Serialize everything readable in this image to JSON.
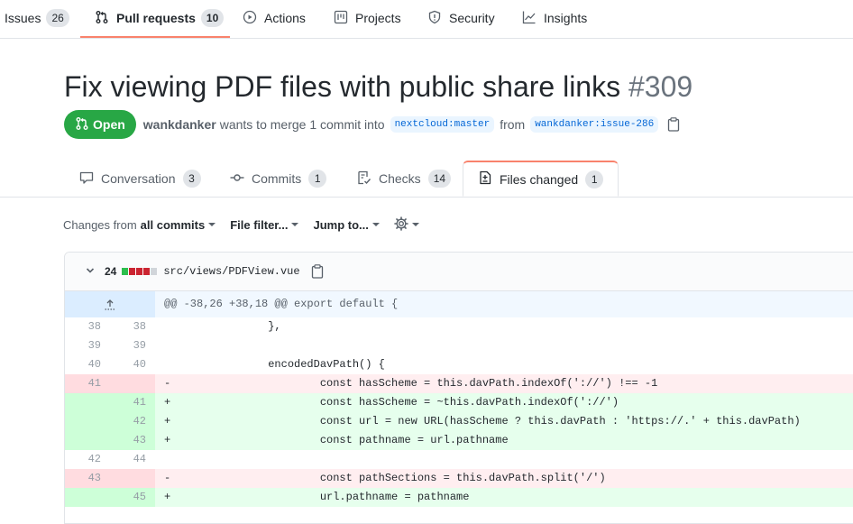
{
  "repo_nav": {
    "items": [
      {
        "label": "Issues",
        "count": "26",
        "icon": "issue-icon"
      },
      {
        "label": "Pull requests",
        "count": "10",
        "icon": "git-pull-request-icon"
      },
      {
        "label": "Actions",
        "icon": "play-icon"
      },
      {
        "label": "Projects",
        "icon": "project-icon"
      },
      {
        "label": "Security",
        "icon": "shield-icon"
      },
      {
        "label": "Insights",
        "icon": "graph-icon"
      }
    ],
    "active_color": "#f9826c"
  },
  "pr": {
    "title": "Fix viewing PDF files with public share links",
    "number": "#309",
    "state": "Open",
    "state_color": "#28a745",
    "author": "wankdanker",
    "merge_text": "wants to merge 1 commit into",
    "base_branch": "nextcloud:master",
    "from_text": "from",
    "head_branch": "wankdanker:issue-286"
  },
  "tabs": [
    {
      "label": "Conversation",
      "count": "3",
      "icon": "comment-icon"
    },
    {
      "label": "Commits",
      "count": "1",
      "icon": "commit-icon"
    },
    {
      "label": "Checks",
      "count": "14",
      "icon": "checklist-icon"
    },
    {
      "label": "Files changed",
      "count": "1",
      "icon": "file-diff-icon",
      "selected": true
    }
  ],
  "toolbar": {
    "changes_from_prefix": "Changes from",
    "changes_from_value": "all commits",
    "file_filter": "File filter...",
    "jump_to": "Jump to...",
    "settings_icon": "gear-icon"
  },
  "file": {
    "changes": "24",
    "diffstat_colors": [
      "#2cbe4e",
      "#cb2431",
      "#cb2431",
      "#cb2431",
      "#d1d5da"
    ],
    "path": "src/views/PDFView.vue",
    "hunk_header": "@@ -38,26 +38,18 @@ export default {",
    "lines": [
      {
        "type": "ctx",
        "old": "38",
        "new": "38",
        "text": "                },"
      },
      {
        "type": "ctx",
        "old": "39",
        "new": "39",
        "text": ""
      },
      {
        "type": "ctx",
        "old": "40",
        "new": "40",
        "text": "                encodedDavPath() {"
      },
      {
        "type": "del",
        "old": "41",
        "new": "",
        "text": "-                       const hasScheme = this.davPath.indexOf('://') !== -1"
      },
      {
        "type": "add",
        "old": "",
        "new": "41",
        "text": "+                       const hasScheme = ~this.davPath.indexOf('://')"
      },
      {
        "type": "add",
        "old": "",
        "new": "42",
        "text": "+                       const url = new URL(hasScheme ? this.davPath : 'https://.' + this.davPath)"
      },
      {
        "type": "add",
        "old": "",
        "new": "43",
        "text": "+                       const pathname = url.pathname"
      },
      {
        "type": "ctx",
        "old": "42",
        "new": "44",
        "text": ""
      },
      {
        "type": "del",
        "old": "43",
        "new": "",
        "text": "-                       const pathSections = this.davPath.split('/')"
      },
      {
        "type": "add",
        "old": "",
        "new": "45",
        "text": "+                       url.pathname = pathname"
      }
    ]
  }
}
